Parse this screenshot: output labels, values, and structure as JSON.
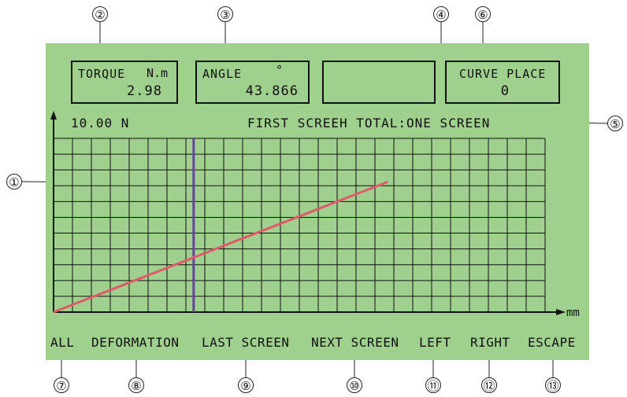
{
  "callouts": {
    "c1": "①",
    "c2": "②",
    "c3": "③",
    "c4": "④",
    "c5": "⑤",
    "c6": "⑥",
    "c7": "⑦",
    "c8": "⑧",
    "c9": "⑨",
    "c10": "⑩",
    "c11": "⑪",
    "c12": "⑫",
    "c13": "⑬"
  },
  "torque": {
    "label": "TORQUE",
    "unit": "N.m",
    "value": "2.98"
  },
  "angle": {
    "label": "ANGLE",
    "unit": "°",
    "value": "43.866"
  },
  "curve_place": {
    "label": "CURVE PLACE",
    "value": "0"
  },
  "graph": {
    "y_axis_label": "10.00 N",
    "x_axis_label": "mm",
    "screen_status": "FIRST SCREEH TOTAL:ONE SCREEN"
  },
  "menu": {
    "all": "ALL",
    "deformation": "DEFORMATION",
    "last_screen": "LAST SCREEN",
    "next_screen": "NEXT SCREEN",
    "left": "LEFT",
    "right": "RIGHT",
    "escape": "ESCAPE"
  },
  "colors": {
    "screen_bg": "#9fd08e",
    "curve": "#e05a6a",
    "cursor": "#6a3fa0",
    "grid": "#111111"
  },
  "chart_data": {
    "type": "line",
    "series": [
      {
        "x": [
          0,
          0.68
        ],
        "y": [
          0,
          0.75
        ]
      }
    ],
    "cursor_x": 0.285,
    "grid": true
  }
}
